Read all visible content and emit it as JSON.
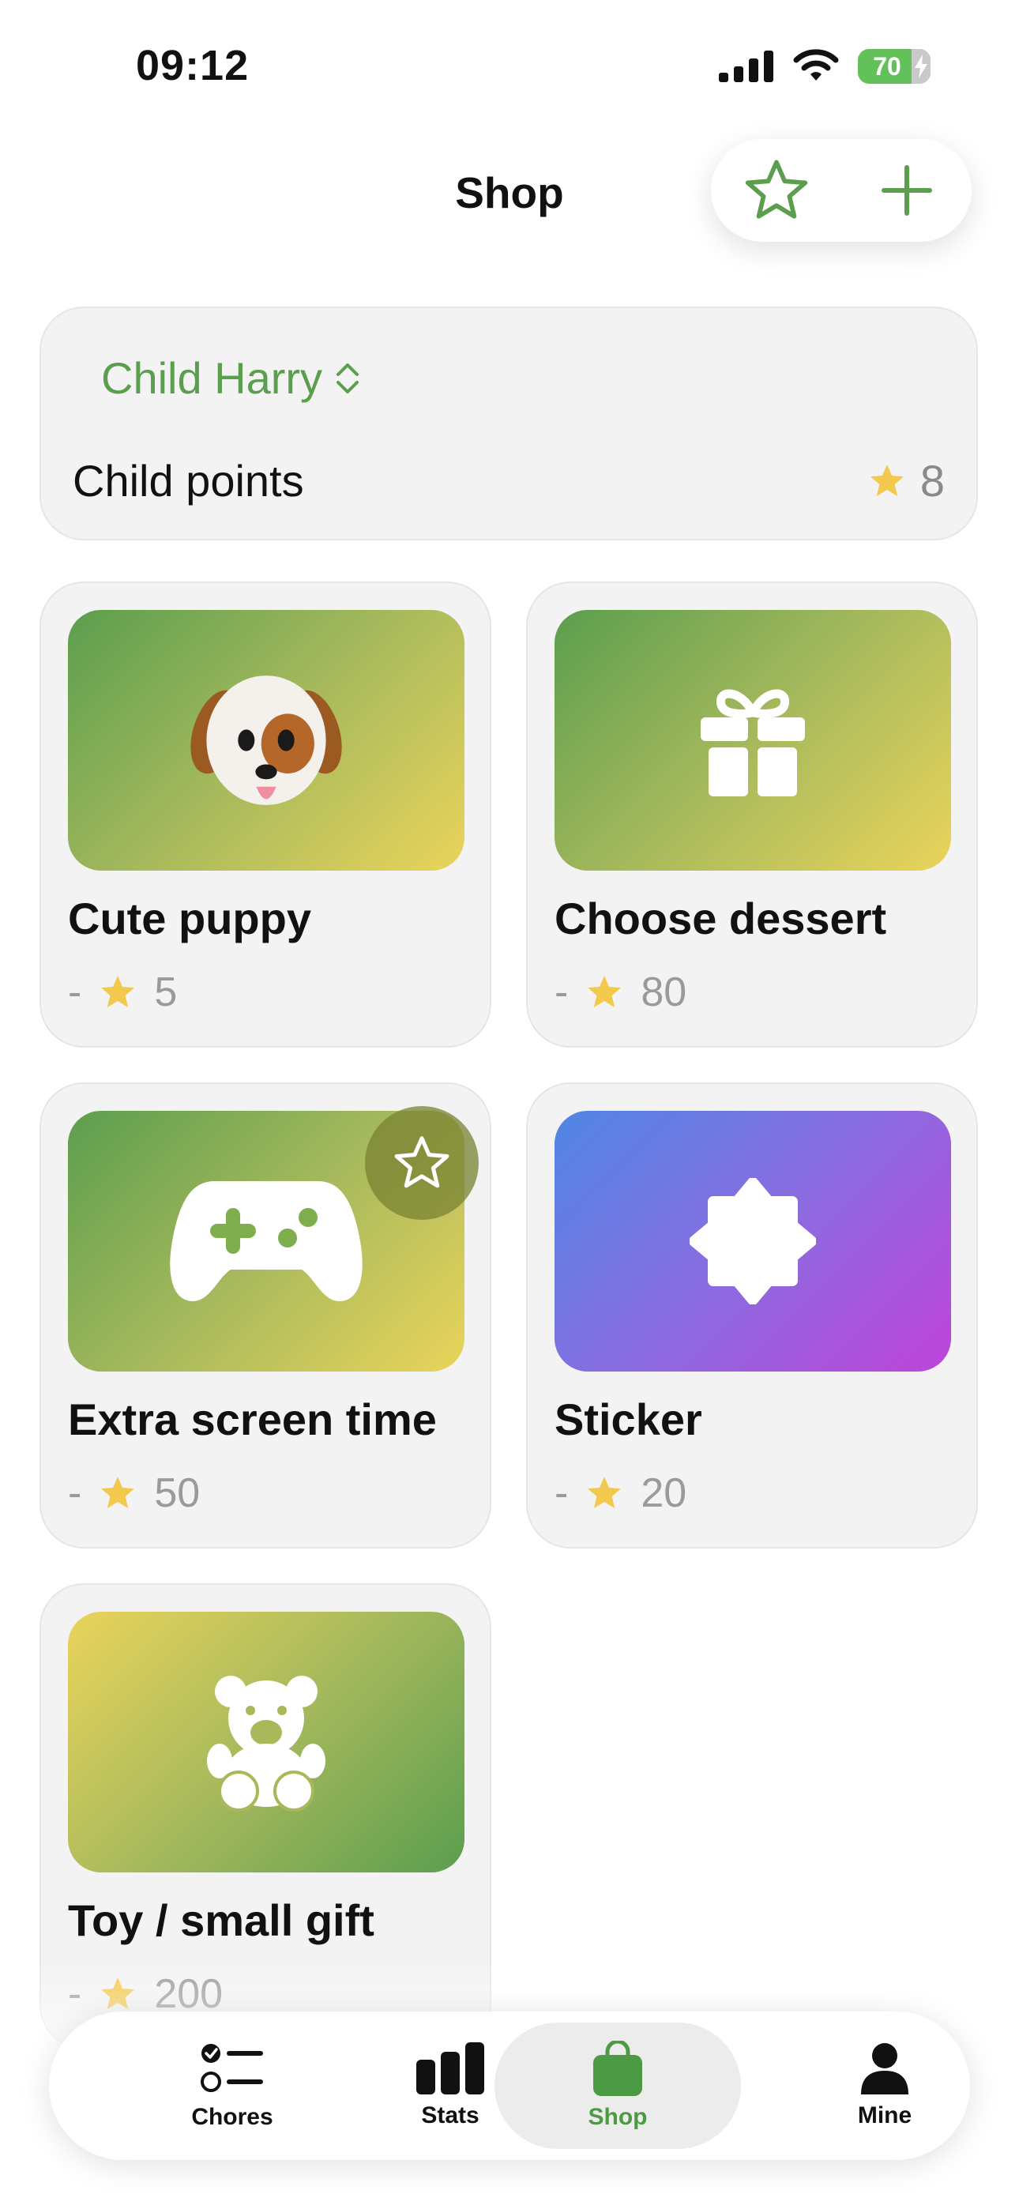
{
  "status_bar": {
    "time": "09:12",
    "battery": "70"
  },
  "header": {
    "title": "Shop",
    "favorites_icon": "star-outline-icon",
    "add_icon": "plus-icon"
  },
  "child": {
    "name": "Child Harry",
    "points_label": "Child points",
    "points": "8"
  },
  "rewards": [
    {
      "name": "Cute puppy",
      "dash": "-",
      "cost": "5",
      "icon": "puppy-emoji"
    },
    {
      "name": "Choose dessert",
      "dash": "-",
      "cost": "80",
      "icon": "gift-icon"
    },
    {
      "name": "Extra screen time",
      "dash": "-",
      "cost": "50",
      "icon": "game-controller-icon",
      "favorite": true
    },
    {
      "name": "Sticker",
      "dash": "-",
      "cost": "20",
      "icon": "sticker-badge-icon"
    },
    {
      "name": "Toy / small gift",
      "dash": "-",
      "cost": "200",
      "icon": "teddy-bear-icon"
    }
  ],
  "tabs": [
    {
      "label": "Chores",
      "icon": "checklist-icon"
    },
    {
      "label": "Stats",
      "icon": "bar-chart-icon"
    },
    {
      "label": "Shop",
      "icon": "shopping-bag-icon",
      "active": true
    },
    {
      "label": "Mine",
      "icon": "person-icon"
    }
  ],
  "colors": {
    "accent": "#5a9e4e",
    "star": "#f2c94c",
    "muted": "#9a9a9a"
  }
}
